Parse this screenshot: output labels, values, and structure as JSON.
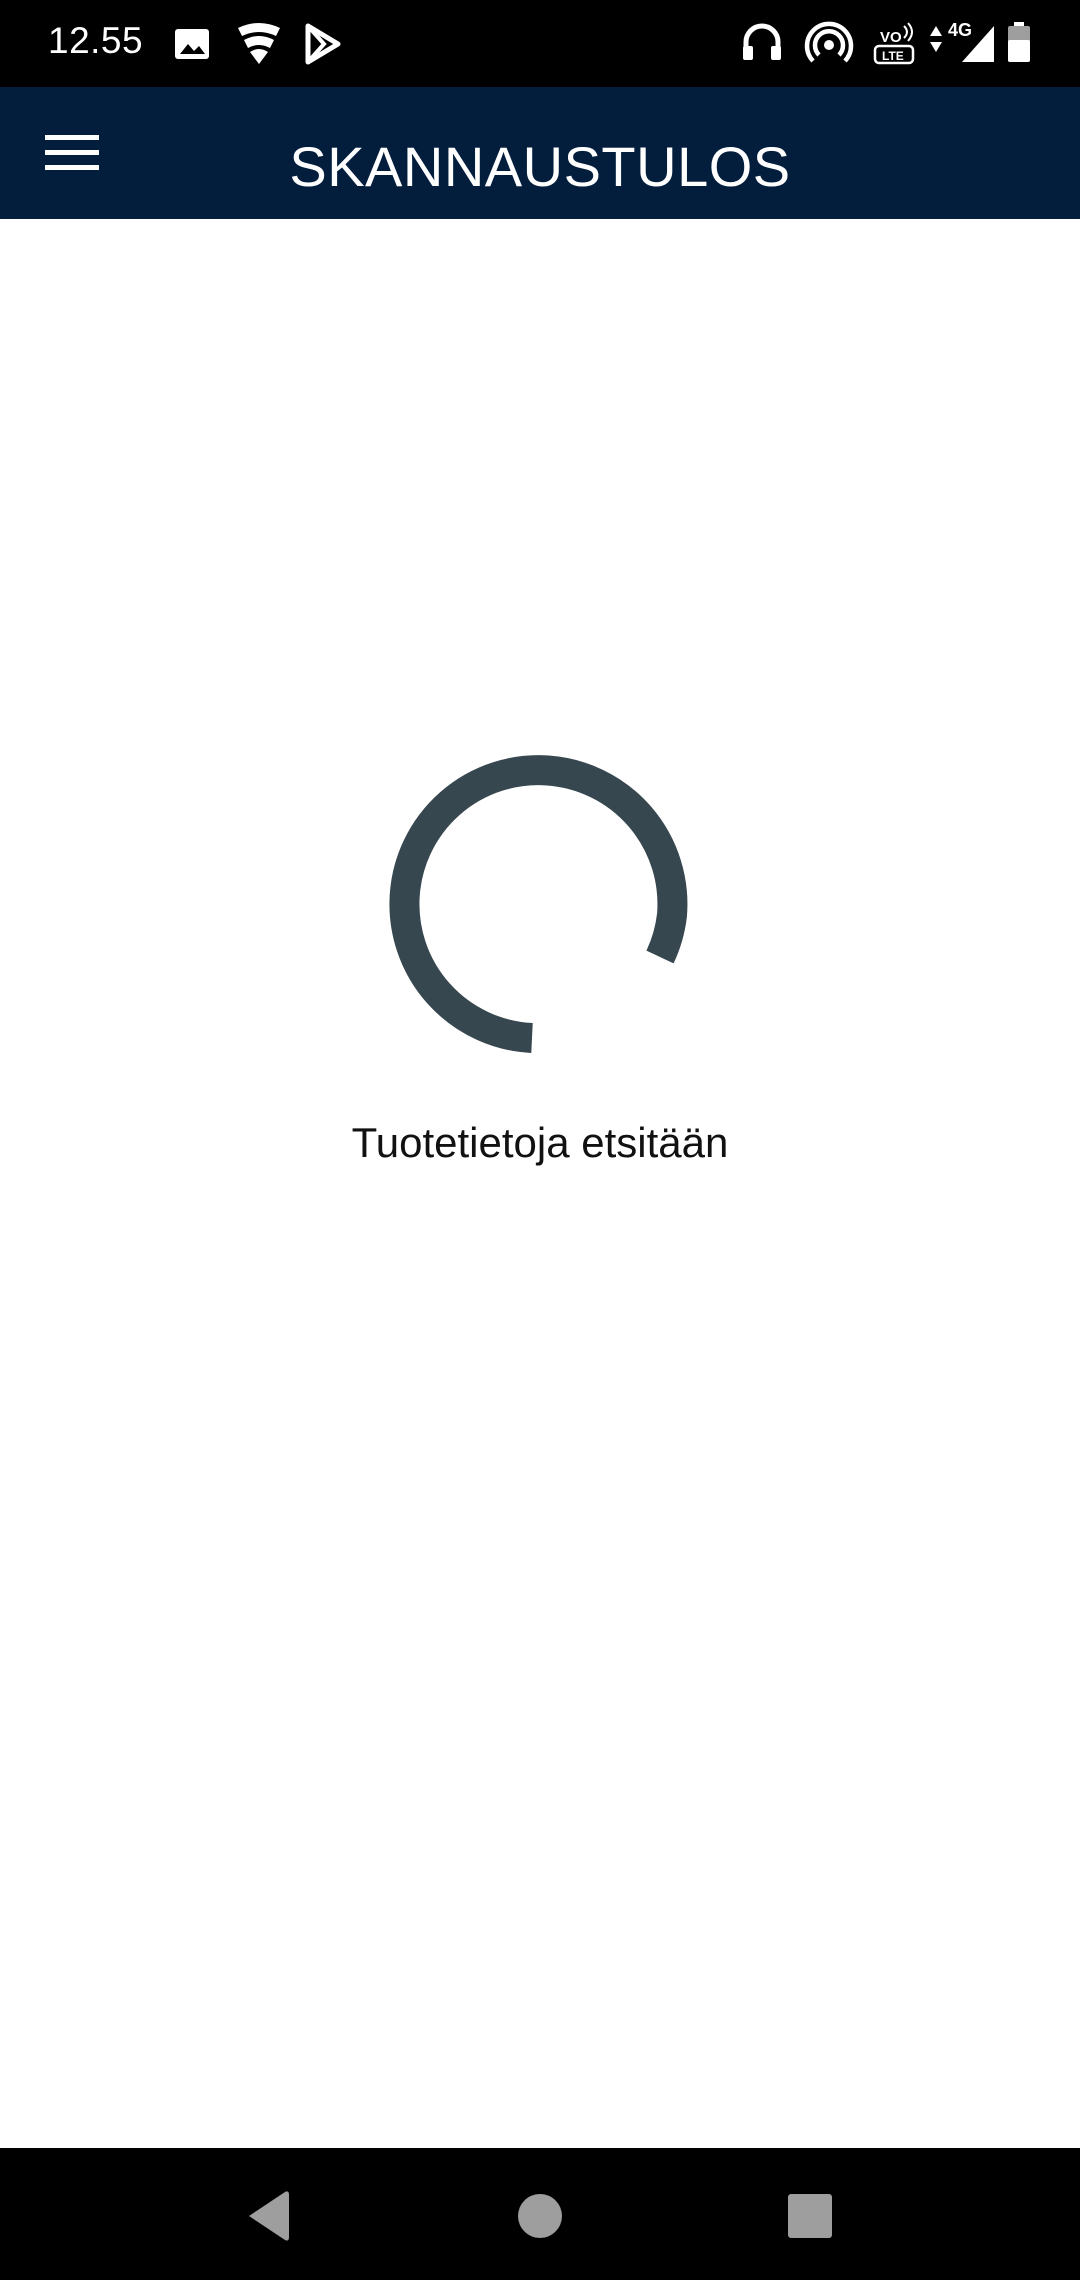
{
  "status_bar": {
    "time": "12.55",
    "network_label": "4G",
    "left_icons": [
      "image-icon",
      "vpn-shield-icon",
      "play-store-icon"
    ],
    "right_icons": [
      "headphones-icon",
      "hotspot-icon",
      "volte-icon",
      "data-arrows-icon",
      "signal-icon",
      "battery-icon"
    ]
  },
  "app_bar": {
    "title": "SKANNAUSTULOS",
    "menu_icon": "hamburger-menu-icon",
    "background": "#031e3d"
  },
  "content": {
    "loading_text": "Tuotetietoja etsitään",
    "spinner_color": "#37474f"
  },
  "nav_bar": {
    "buttons": [
      "back-icon",
      "home-icon",
      "recents-icon"
    ]
  }
}
